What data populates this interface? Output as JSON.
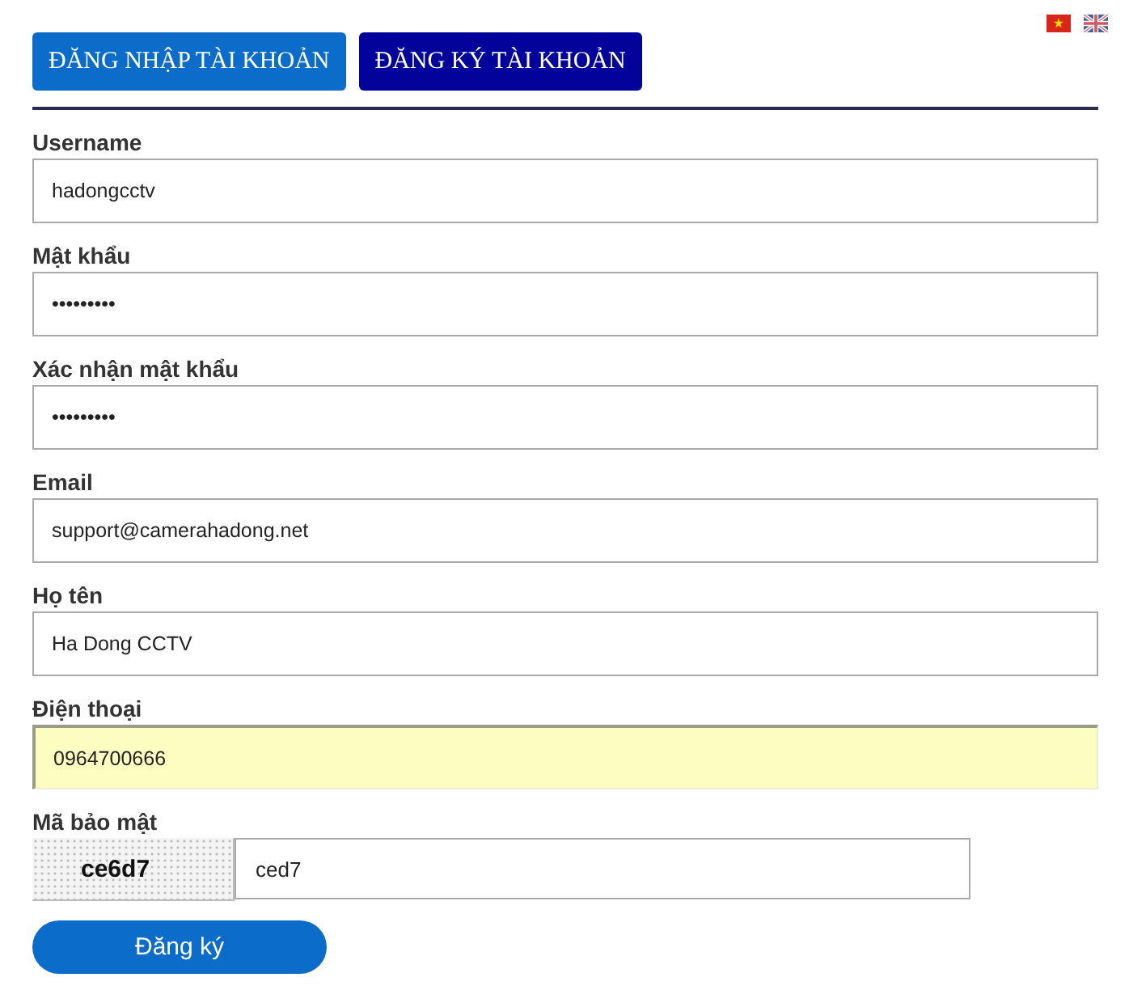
{
  "language_flags": [
    {
      "kind": "vietnam"
    },
    {
      "kind": "uk"
    }
  ],
  "tabs": [
    {
      "label": "ĐĂNG NHẬP TÀI KHOẢN",
      "selected": false
    },
    {
      "label": "ĐĂNG KÝ TÀI KHOẢN",
      "selected": true
    }
  ],
  "fields": [
    {
      "label": "Username",
      "value": "hadongcctv",
      "highlighted": false
    },
    {
      "label": "Mật khẩu",
      "value": "•••••••••",
      "highlighted": false
    },
    {
      "label": "Xác nhận mật khẩu",
      "value": "•••••••••",
      "highlighted": false
    },
    {
      "label": "Email",
      "value": "support@camerahadong.net",
      "highlighted": false
    },
    {
      "label": "Họ tên",
      "value": "Ha Dong CCTV",
      "highlighted": false
    },
    {
      "label": "Điện thoại",
      "value": "0964700666",
      "highlighted": true
    }
  ],
  "captcha": {
    "label": "Mã bảo mật",
    "code": "ce6d7",
    "value": "ced7"
  },
  "submit_button": "Đăng ký"
}
